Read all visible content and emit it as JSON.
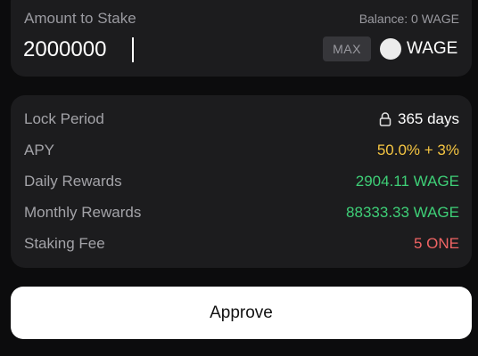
{
  "stake": {
    "label": "Amount to Stake",
    "balance": "Balance: 0 WAGE",
    "amount": "2000000",
    "max_label": "MAX",
    "token_symbol": "WAGE"
  },
  "details": {
    "rows": [
      {
        "label": "Lock Period",
        "value": "365 days",
        "icon": "lock-icon",
        "color": "#ffffff"
      },
      {
        "label": "APY",
        "value": "50.0% + 3%",
        "color": "#f5c542"
      },
      {
        "label": "Daily Rewards",
        "value": "2904.11 WAGE",
        "color": "#3ecf77"
      },
      {
        "label": "Monthly Rewards",
        "value": "88333.33 WAGE",
        "color": "#3ecf77"
      },
      {
        "label": "Staking Fee",
        "value": "5 ONE",
        "color": "#f06464"
      }
    ]
  },
  "actions": {
    "approve_label": "Approve"
  }
}
